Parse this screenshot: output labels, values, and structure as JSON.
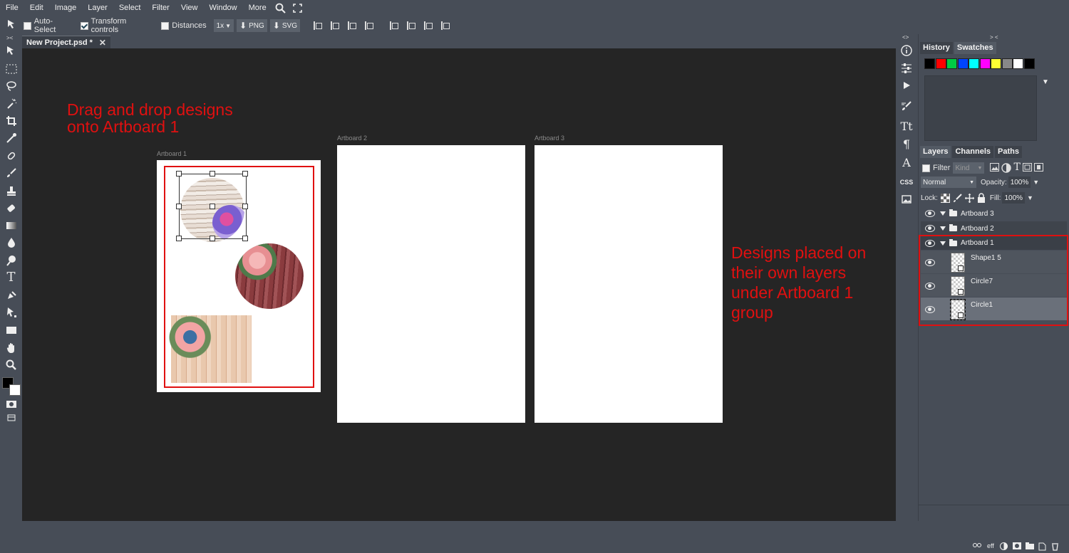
{
  "menu": {
    "items": [
      "File",
      "Edit",
      "Image",
      "Layer",
      "Select",
      "Filter",
      "View",
      "Window",
      "More"
    ]
  },
  "options": {
    "auto_select": "Auto-Select",
    "transform_controls": "Transform controls",
    "distances": "Distances",
    "zoom": "1x",
    "png": "PNG",
    "svg": "SVG"
  },
  "tab": {
    "title": "New Project.psd *",
    "close": "✕"
  },
  "canvas": {
    "artboards": [
      {
        "label": "Artboard 1"
      },
      {
        "label": "Artboard 2"
      },
      {
        "label": "Artboard 3"
      }
    ],
    "annotation_left": [
      "Drag and drop designs",
      "onto Artboard 1"
    ],
    "annotation_right": [
      "Designs placed on",
      "their own layers",
      "under Artboard 1",
      "group"
    ]
  },
  "right_icons": {
    "css": "CSS"
  },
  "panel": {
    "top_tabs": [
      "History",
      "Swatches"
    ],
    "collapse": "> <",
    "swatch_colors": [
      "#000000",
      "#ff0000",
      "#00cc44",
      "#0044ff",
      "#00ffff",
      "#ff00ff",
      "#ffff33",
      "#888888",
      "#ffffff",
      "#000000"
    ],
    "layer_tabs": [
      "Layers",
      "Channels",
      "Paths"
    ],
    "filter_label": "Filter",
    "kind_placeholder": "Kind",
    "blend_mode": "Normal",
    "opacity_label": "Opacity:",
    "opacity_value": "100%",
    "lock_label": "Lock:",
    "fill_label": "Fill:",
    "fill_value": "100%",
    "layers": [
      {
        "name": "Artboard 3",
        "type": "group"
      },
      {
        "name": "Artboard 2",
        "type": "group"
      },
      {
        "name": "Artboard 1",
        "type": "group"
      },
      {
        "name": "Shape1 5",
        "type": "layer"
      },
      {
        "name": "Circle7",
        "type": "layer"
      },
      {
        "name": "Circle1",
        "type": "layer",
        "selected": true
      }
    ],
    "footer_eff": "eff"
  },
  "accent_red": "#e01010"
}
